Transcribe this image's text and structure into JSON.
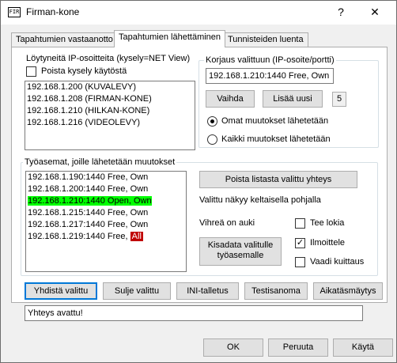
{
  "window": {
    "title": "Firman-kone",
    "icon_text": "FIR",
    "help": "?",
    "close": "✕"
  },
  "tabs": [
    {
      "label": "Tapahtumien vastaanotto"
    },
    {
      "label": "Tapahtumien lähettäminen"
    },
    {
      "label": "Tunnisteiden luenta"
    }
  ],
  "found": {
    "label": "Löytyneitä IP-osoitteita (kysely=NET View)",
    "remove_query_label": "Poista kysely käytöstä",
    "remove_query_checked": false,
    "items": [
      "192.168.1.200 (KUVALEVY)",
      "192.168.1.208 (FIRMAN-KONE)",
      "192.168.1.210 (HILKAN-KONE)",
      "192.168.1.216 (VIDEOLEVY)"
    ]
  },
  "fix": {
    "label": "Korjaus valittuun (IP-osoite/portti)",
    "value": "192.168.1.210:1440 Free, Own",
    "change_btn": "Vaihda",
    "add_btn": "Lisää uusi",
    "count": "5",
    "radio_own": "Omat muutokset lähetetään",
    "radio_all": "Kaikki muutokset lähetetään",
    "radio_own_selected": true
  },
  "workstations": {
    "label": "Työasemat, joille lähetetään muutokset",
    "items": [
      {
        "text": "192.168.1.190:1440 Free, Own",
        "style": "normal"
      },
      {
        "text": "192.168.1.200:1440 Free, Own",
        "style": "normal"
      },
      {
        "text": "192.168.1.210:1440 Open, Own",
        "style": "green"
      },
      {
        "text": "192.168.1.215:1440 Free, Own",
        "style": "normal"
      },
      {
        "text": "192.168.1.217:1440 Free, Own",
        "style": "normal"
      },
      {
        "text": "192.168.1.219:1440 Free, ",
        "style": "normal",
        "suffix": "All"
      }
    ],
    "remove_btn": "Poista listasta valittu yhteys",
    "info_yellow": "Valittu näkyy keltaisella pohjalla",
    "info_green": "Vihreä on auki",
    "log_label": "Tee lokia",
    "log_checked": false,
    "notify_label": "Ilmoittele",
    "notify_checked": true,
    "ack_label": "Vaadi kuittaus",
    "ack_checked": false,
    "kisadata_btn_line1": "Kisadata valitulle",
    "kisadata_btn_line2": "työasemalle"
  },
  "actions": {
    "connect": "Yhdistä valittu",
    "close_sel": "Sulje valittu",
    "ini": "INI-talletus",
    "test": "Testisanoma",
    "timesync": "Aikatäsmäytys"
  },
  "status": "Yhteys avattu!",
  "footer": {
    "ok": "OK",
    "cancel": "Peruuta",
    "apply": "Käytä"
  }
}
